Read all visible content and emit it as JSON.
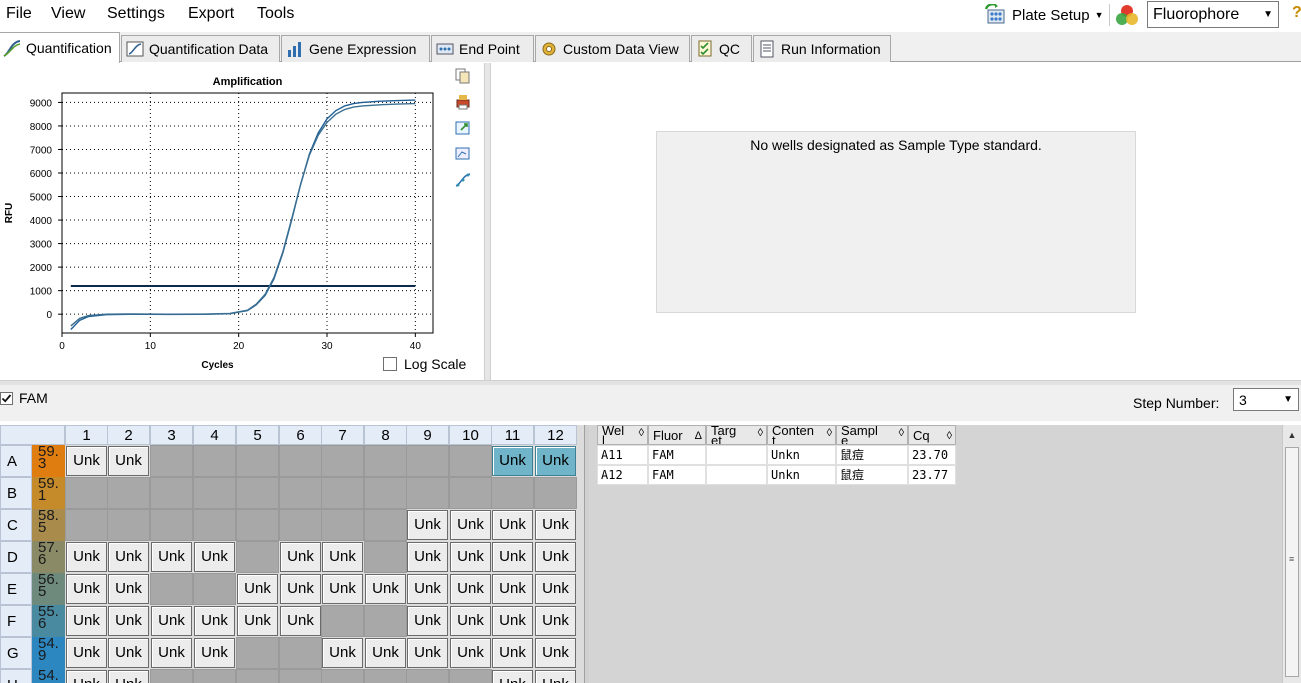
{
  "menu": {
    "file": "File",
    "view": "View",
    "settings": "Settings",
    "export": "Export",
    "tools": "Tools"
  },
  "toolbar": {
    "plate_setup": "Plate Setup",
    "fluorophore": "Fluorophore",
    "help": "?"
  },
  "tabs": [
    "Quantification",
    "Quantification Data",
    "Gene Expression",
    "End Point",
    "Custom Data View",
    "QC",
    "Run Information"
  ],
  "chart_title": "Amplification",
  "log_scale_label": "Log Scale",
  "standard_message": "No wells designated as Sample Type standard.",
  "fam_label": "FAM",
  "step": {
    "label": "Step Number:",
    "value": "3"
  },
  "plate": {
    "columns": [
      "1",
      "2",
      "3",
      "4",
      "5",
      "6",
      "7",
      "8",
      "9",
      "10",
      "11",
      "12"
    ],
    "rows": [
      "A",
      "B",
      "C",
      "D",
      "E",
      "F",
      "G",
      "H"
    ],
    "temps": [
      "59.\n3",
      "59.\n1",
      "58.\n5",
      "57.\n6",
      "56.\n5",
      "55.\n6",
      "54.\n9",
      "54."
    ],
    "temp_colors": [
      "#e07d10",
      "#c58a2a",
      "#a98b4c",
      "#8a8a66",
      "#6d8a7c",
      "#4a8aa0",
      "#2c86c0",
      "#2c86c0"
    ],
    "label": "Unk",
    "wells": [
      [
        1,
        1,
        0,
        0,
        0,
        0,
        0,
        0,
        0,
        0,
        2,
        2
      ],
      [
        0,
        0,
        0,
        0,
        0,
        0,
        0,
        0,
        0,
        0,
        0,
        0
      ],
      [
        0,
        0,
        0,
        0,
        0,
        0,
        0,
        0,
        1,
        1,
        1,
        1
      ],
      [
        1,
        1,
        1,
        1,
        0,
        1,
        1,
        0,
        1,
        1,
        1,
        1
      ],
      [
        1,
        1,
        0,
        0,
        1,
        1,
        1,
        1,
        1,
        1,
        1,
        1
      ],
      [
        1,
        1,
        1,
        1,
        1,
        1,
        0,
        0,
        1,
        1,
        1,
        1
      ],
      [
        1,
        1,
        1,
        1,
        0,
        0,
        1,
        1,
        1,
        1,
        1,
        1
      ],
      [
        1,
        1,
        0,
        0,
        0,
        0,
        0,
        0,
        0,
        0,
        1,
        1
      ]
    ]
  },
  "table": {
    "headers": [
      "Wel\nl",
      "Fluor",
      "Targ\net",
      "Conten\nt",
      "Sampl\ne",
      "Cq"
    ],
    "sort_glyphs": [
      "◊",
      "Δ",
      "◊",
      "◊",
      "◊",
      "◊"
    ],
    "rows": [
      [
        "A11",
        "FAM",
        "",
        "Unkn",
        "鼠痘",
        "23.70"
      ],
      [
        "A12",
        "FAM",
        "",
        "Unkn",
        "鼠痘",
        "23.77"
      ]
    ]
  },
  "chart_data": {
    "type": "line",
    "title": "Amplification",
    "xlabel": "Cycles",
    "ylabel": "RFU",
    "xlim": [
      0,
      42
    ],
    "ylim": [
      -800,
      9400
    ],
    "xticks": [
      0,
      10,
      20,
      30,
      40
    ],
    "yticks": [
      0,
      1000,
      2000,
      3000,
      4000,
      5000,
      6000,
      7000,
      8000,
      9000
    ],
    "grid": true,
    "threshold": 1200,
    "series": [
      {
        "x": [
          1,
          2,
          3,
          5,
          8,
          12,
          16,
          19,
          21,
          22,
          23,
          24,
          25,
          26,
          27,
          28,
          29,
          30,
          31,
          32,
          33,
          34,
          36,
          38,
          40
        ],
        "y": [
          -650,
          -260,
          -100,
          -20,
          0,
          -10,
          -5,
          20,
          150,
          400,
          800,
          1500,
          2600,
          4000,
          5500,
          6800,
          7700,
          8300,
          8650,
          8850,
          8950,
          9000,
          9050,
          9080,
          9100
        ]
      },
      {
        "x": [
          1,
          2,
          3,
          5,
          8,
          12,
          16,
          19,
          21,
          22,
          23,
          24,
          25,
          26,
          27,
          28,
          29,
          30,
          31,
          32,
          33,
          34,
          36,
          38,
          40
        ],
        "y": [
          -500,
          -180,
          -60,
          0,
          10,
          0,
          5,
          30,
          170,
          430,
          850,
          1560,
          2650,
          4050,
          5500,
          6750,
          7600,
          8150,
          8500,
          8700,
          8800,
          8850,
          8900,
          8930,
          8950
        ]
      }
    ]
  }
}
